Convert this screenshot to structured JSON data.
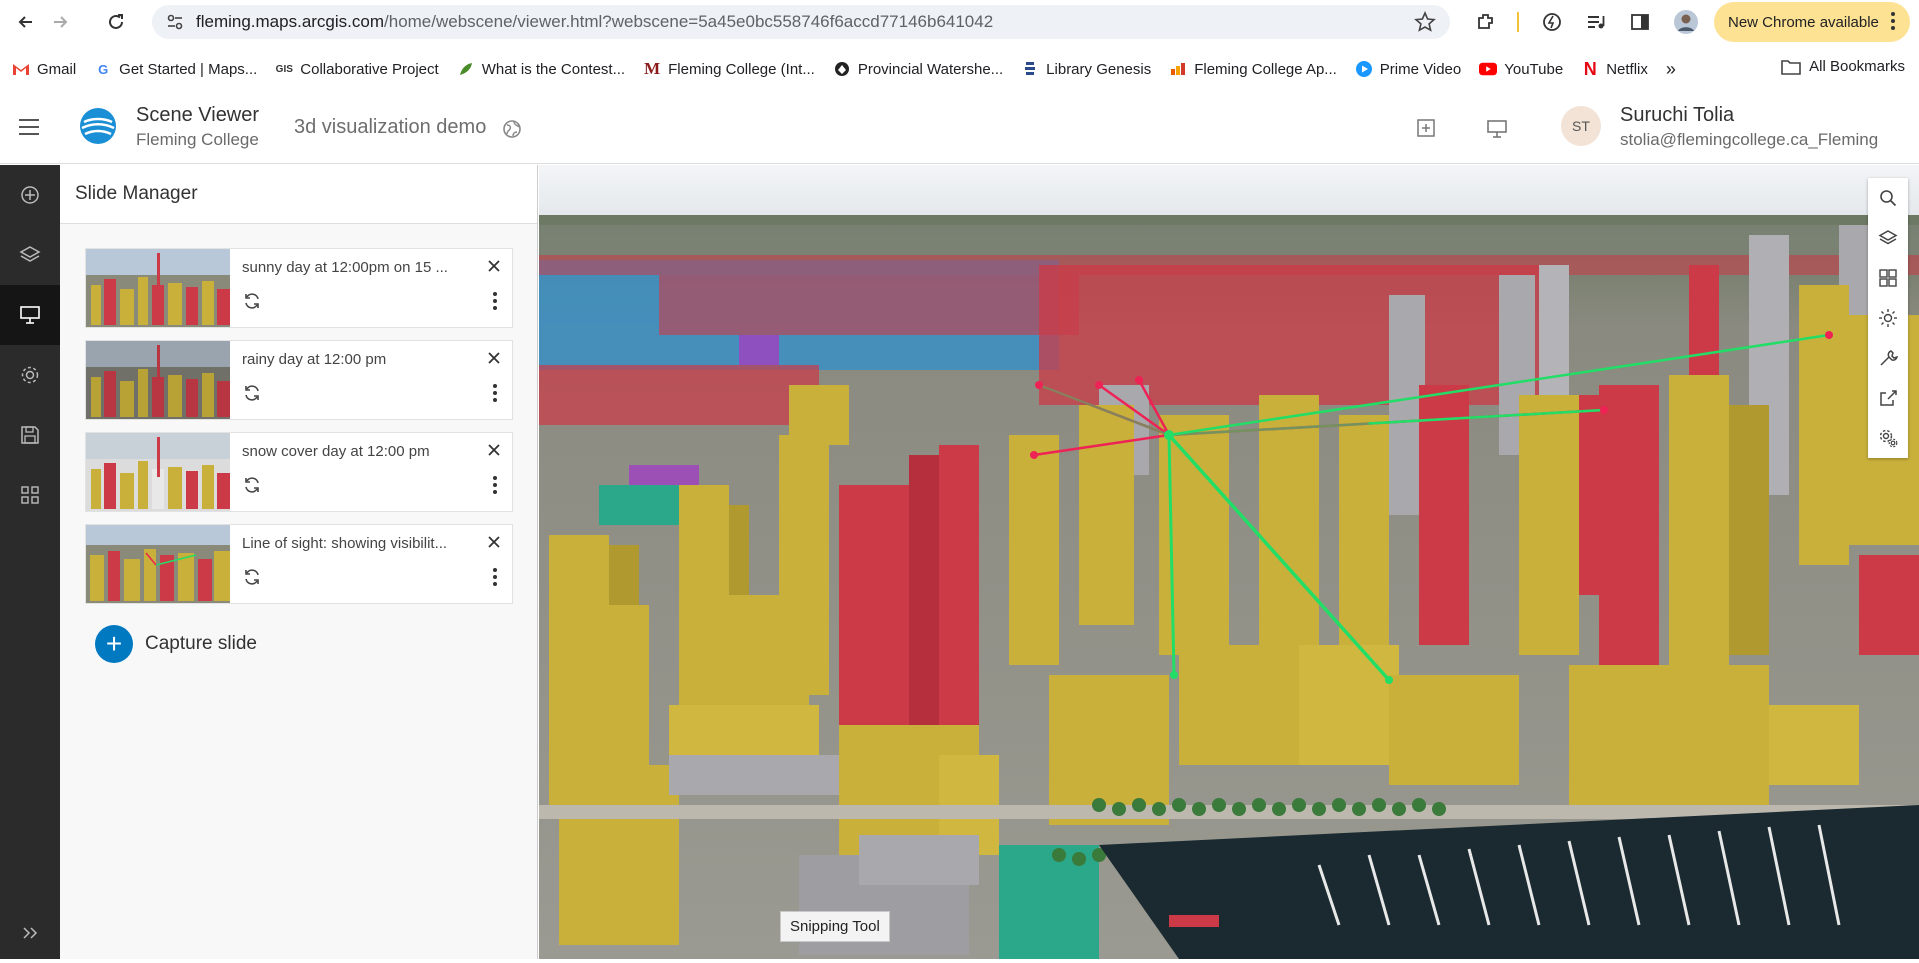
{
  "browser": {
    "url_host": "fleming.maps.arcgis.com",
    "url_path": "/home/webscene/viewer.html?webscene=5a45e0bc558746f6accd77146b641042",
    "update_label": "New Chrome available",
    "bookmarks": [
      {
        "label": "Gmail",
        "icon": "gmail-icon",
        "color": "#ea4335"
      },
      {
        "label": "Get Started | Maps...",
        "icon": "google-icon",
        "color": "#4285f4"
      },
      {
        "label": "Collaborative Project",
        "icon": "gis-icon",
        "color": "#333333"
      },
      {
        "label": "What is the Contest...",
        "icon": "leaf-icon",
        "color": "#4a8c2a"
      },
      {
        "label": "Fleming College (Int...",
        "icon": "fleming-m-icon",
        "color": "#8a1c1c"
      },
      {
        "label": "Provincial Watershe...",
        "icon": "watershed-icon",
        "color": "#222222"
      },
      {
        "label": "Library Genesis",
        "icon": "library-icon",
        "color": "#2b4a8c"
      },
      {
        "label": "Fleming College Ap...",
        "icon": "chart-icon",
        "color": "#e65c00"
      },
      {
        "label": "Prime Video",
        "icon": "prime-video-icon",
        "color": "#1a98ff"
      },
      {
        "label": "YouTube",
        "icon": "youtube-icon",
        "color": "#ff0000"
      },
      {
        "label": "Netflix",
        "icon": "netflix-icon",
        "color": "#e50914"
      }
    ],
    "all_bookmarks": "All Bookmarks"
  },
  "app": {
    "title": "Scene Viewer",
    "org": "Fleming College",
    "scene_name": "3d visualization demo",
    "user_initials": "ST",
    "user_name": "Suruchi Tolia",
    "user_email": "stolia@flemingcollege.ca_Fleming"
  },
  "panel": {
    "title": "Slide Manager",
    "slides": [
      {
        "title": "sunny day at 12:00pm on 15 ..."
      },
      {
        "title": "rainy day at 12:00 pm"
      },
      {
        "title": "snow cover day at 12:00 pm"
      },
      {
        "title": "Line of sight: showing visibilit..."
      }
    ],
    "capture_label": "Capture slide"
  },
  "tooltip": "Snipping Tool",
  "colors": {
    "accent": "#0079c1",
    "building_yellow": "#c8b03a",
    "building_red": "#cc3a47",
    "building_grey": "#a9a9ad",
    "building_blue": "#3a8fc6",
    "sight_visible": "#22dd66",
    "sight_hidden": "#ee2255"
  }
}
